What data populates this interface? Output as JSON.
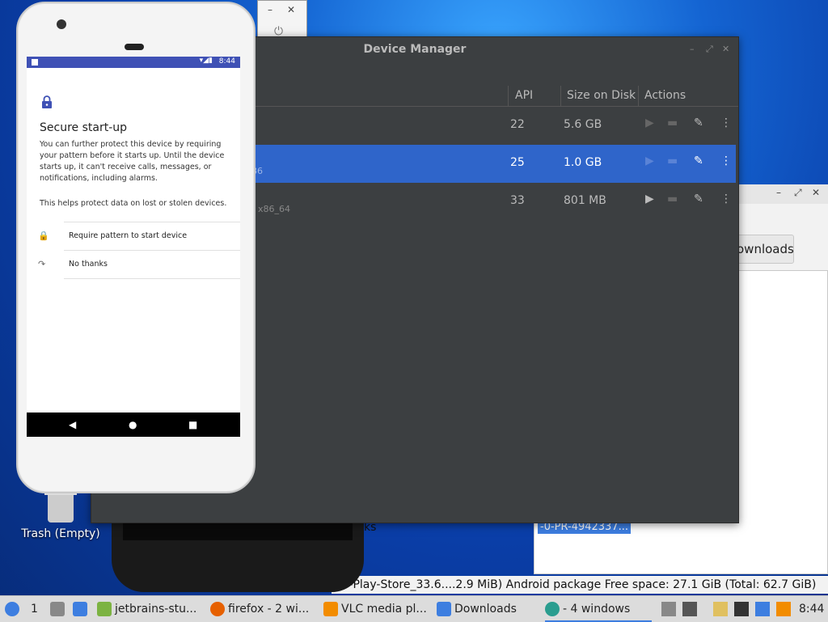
{
  "file_manager": {
    "window_controls": [
      "–",
      "⤢",
      "✕"
    ],
    "toolbar_button": "ownloads",
    "selected_file": "-0-PR-4942337...",
    "partial_text": "ks",
    "status_text": "gle-Play-Store_33.6....2.9 MiB) Android package   Free space: 27.1 GiB (Total: 62.7 GiB)"
  },
  "mini_window": {
    "minimize": "–",
    "close": "✕",
    "power_glyph": "⏻"
  },
  "desktop": {
    "trash_label": "Trash (Empty)"
  },
  "device_manager": {
    "title": "Device Manager",
    "window_controls": [
      "–",
      "⤢",
      "✕"
    ],
    "columns": {
      "api": "API",
      "size": "Size on Disk",
      "actions": "Actions"
    },
    "rows": [
      {
        "api": "22",
        "size": "5.6 GB",
        "sub": "",
        "selected": false
      },
      {
        "api": "25",
        "size": "1.0 GB",
        "sub": "86",
        "selected": true
      },
      {
        "api": "33",
        "size": "801 MB",
        "sub": "x86_64",
        "selected": false
      }
    ],
    "action_icons": [
      "play-icon",
      "folder-icon",
      "pencil-icon",
      "more-vert-icon"
    ]
  },
  "emulator": {
    "status_time": "8:44",
    "status_icons": "▾◢▮",
    "title": "Secure start-up",
    "paragraph1": "You can further protect this device by requiring your pattern before it starts up. Until the device starts up, it can't receive calls, messages, or notifications, including alarms.",
    "paragraph2": "This helps protect data on lost or stolen devices.",
    "options": [
      {
        "icon": "lock-icon",
        "glyph": "🔒",
        "label": "Require pattern to start device"
      },
      {
        "icon": "skip-arrow-icon",
        "glyph": "↷",
        "label": "No thanks"
      }
    ],
    "nav": {
      "back": "◀",
      "home": "●",
      "recents": "■"
    }
  },
  "taskbar": {
    "workspace": "1",
    "items": [
      {
        "label": "jetbrains-stu...",
        "color": "#7cb342"
      },
      {
        "label": "firefox - 2 wi...",
        "color": "#e66000"
      },
      {
        "label": "VLC media pl...",
        "color": "#f28c00"
      },
      {
        "label": "Downloads",
        "color": "#3d7ee0"
      },
      {
        "label": "- 4 windows",
        "color": "#2a9d8f"
      }
    ],
    "clock": "8:44"
  }
}
